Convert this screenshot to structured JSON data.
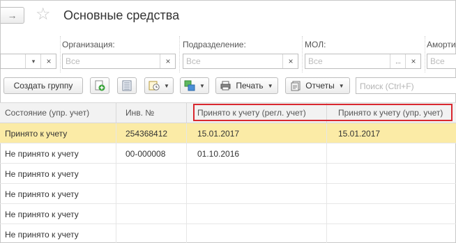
{
  "window": {
    "title": "Основные средства"
  },
  "filters": {
    "organization": {
      "label": "Организация:",
      "placeholder": "Все"
    },
    "department": {
      "label": "Подразделение:",
      "placeholder": "Все"
    },
    "mol": {
      "label": "МОЛ:",
      "placeholder": "Все",
      "ellipsis": "..."
    },
    "amort": {
      "label": "Аморти",
      "placeholder": "Все"
    },
    "clear_symbol": "×",
    "dropdown_symbol": "▾"
  },
  "toolbar": {
    "create_group_label": "Создать группу",
    "print_label": "Печать",
    "reports_label": "Отчеты",
    "search_placeholder": "Поиск (Ctrl+F)"
  },
  "table": {
    "columns": [
      "Состояние (упр. учет)",
      "Инв. №",
      "Принято к учету (регл. учет)",
      "Принято к учету (упр. учет)"
    ],
    "rows": [
      {
        "state": "Принято к учету",
        "inv": "254368412",
        "reg_date": "15.01.2017",
        "upr_date": "15.01.2017",
        "selected": true
      },
      {
        "state": "Не принято к учету",
        "inv": "00-000008",
        "reg_date": "01.10.2016",
        "upr_date": ""
      },
      {
        "state": "Не принято к учету",
        "inv": "",
        "reg_date": "",
        "upr_date": ""
      },
      {
        "state": "Не принято к учету",
        "inv": "",
        "reg_date": "",
        "upr_date": ""
      },
      {
        "state": "Не принято к учету",
        "inv": "",
        "reg_date": "",
        "upr_date": ""
      },
      {
        "state": "Не принято к учету",
        "inv": "",
        "reg_date": "",
        "upr_date": ""
      }
    ]
  },
  "colors": {
    "selected_row": "#fbeba6",
    "highlight_border": "#d9282f"
  }
}
